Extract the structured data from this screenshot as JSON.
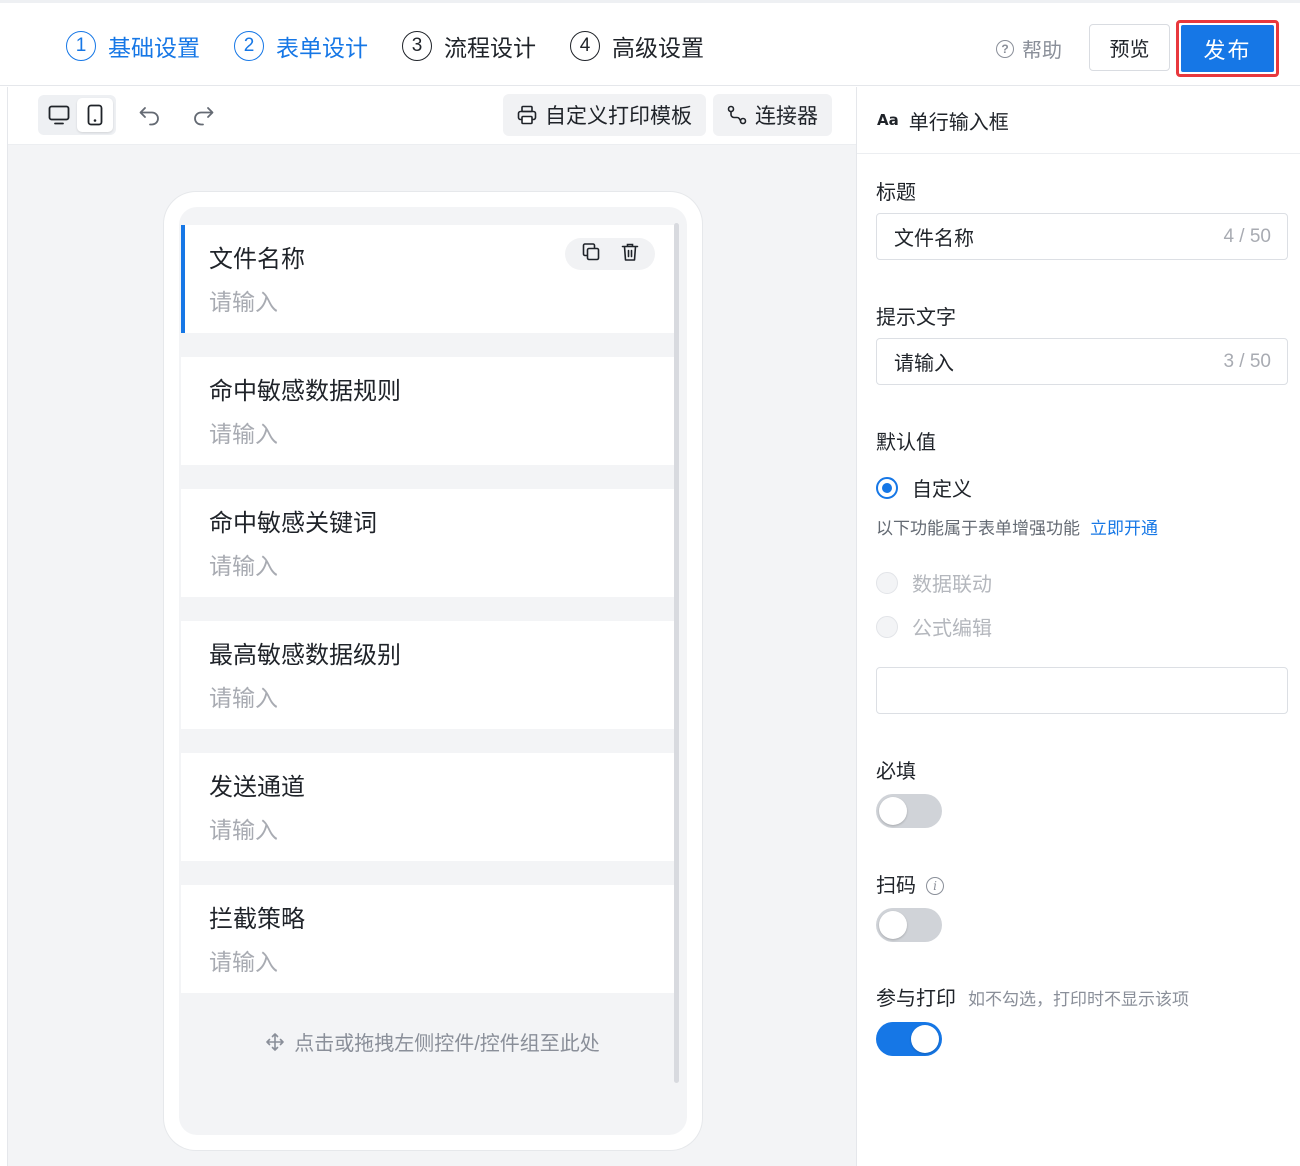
{
  "steps": [
    {
      "num": "1",
      "label": "基础设置"
    },
    {
      "num": "2",
      "label": "表单设计"
    },
    {
      "num": "3",
      "label": "流程设计"
    },
    {
      "num": "4",
      "label": "高级设置"
    }
  ],
  "header": {
    "help_label": "帮助",
    "preview_label": "预览",
    "publish_label": "发布"
  },
  "toolbar": {
    "print_template_label": "自定义打印模板",
    "connector_label": "连接器"
  },
  "form": {
    "fields": [
      {
        "label": "文件名称",
        "placeholder": "请输入"
      },
      {
        "label": "命中敏感数据规则",
        "placeholder": "请输入"
      },
      {
        "label": "命中敏感关键词",
        "placeholder": "请输入"
      },
      {
        "label": "最高敏感数据级别",
        "placeholder": "请输入"
      },
      {
        "label": "发送通道",
        "placeholder": "请输入"
      },
      {
        "label": "拦截策略",
        "placeholder": "请输入"
      }
    ],
    "drop_hint": "点击或拖拽左侧控件/控件组至此处"
  },
  "panel": {
    "control_type_icon": "Aa",
    "control_type": "单行输入框",
    "title_label": "标题",
    "title_value": "文件名称",
    "title_count": "4 / 50",
    "hint_label": "提示文字",
    "hint_value": "请输入",
    "hint_count": "3 / 50",
    "default_label": "默认值",
    "default_options": [
      "自定义",
      "数据联动",
      "公式编辑"
    ],
    "enhance_note": "以下功能属于表单增强功能",
    "enhance_link": "立即开通",
    "default_value": "",
    "required_label": "必填",
    "required_on": false,
    "scan_label": "扫码",
    "scan_on": false,
    "print_label": "参与打印",
    "print_note": "如不勾选，打印时不显示该项",
    "print_on": true
  },
  "colors": {
    "accent": "#1677e6",
    "highlight_border": "#e8383d"
  }
}
